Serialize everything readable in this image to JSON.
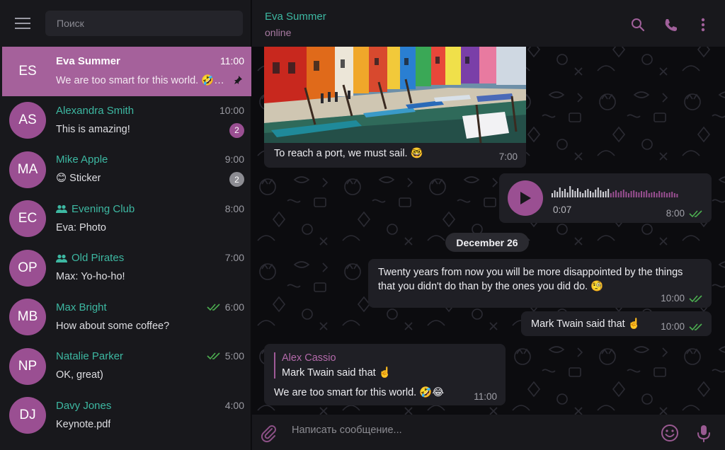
{
  "sidebar": {
    "search_placeholder": "Поиск",
    "chats": [
      {
        "initials": "ES",
        "name": "Eva Summer",
        "time": "11:00",
        "preview": "We are too smart for this world. 🤣😂",
        "pinned": true,
        "active": true,
        "group": false,
        "badge": "",
        "read": false
      },
      {
        "initials": "AS",
        "name": "Alexandra Smith",
        "time": "10:00",
        "preview": "This is amazing!",
        "badge": "2",
        "badge_style": "accent",
        "group": false,
        "read": false
      },
      {
        "initials": "MA",
        "name": "Mike Apple",
        "time": "9:00",
        "preview": "😊 Sticker",
        "badge": "2",
        "badge_style": "muted",
        "group": false,
        "read": false
      },
      {
        "initials": "EC",
        "name": "Evening Club",
        "time": "8:00",
        "preview": "Eva: Photo",
        "badge": "",
        "group": true,
        "read": false
      },
      {
        "initials": "OP",
        "name": "Old Pirates",
        "time": "7:00",
        "preview": "Max: Yo-ho-ho!",
        "badge": "",
        "group": true,
        "read": false
      },
      {
        "initials": "MB",
        "name": "Max Bright",
        "time": "6:00",
        "preview": "How about some coffee?",
        "badge": "",
        "group": false,
        "read": true
      },
      {
        "initials": "NP",
        "name": "Natalie Parker",
        "time": "5:00",
        "preview": "OK, great)",
        "badge": "",
        "group": false,
        "read": true
      },
      {
        "initials": "DJ",
        "name": "Davy Jones",
        "time": "4:00",
        "preview": "Keynote.pdf",
        "badge": "",
        "group": false,
        "read": false
      }
    ]
  },
  "header": {
    "name": "Eva Summer",
    "status": "online"
  },
  "messages": {
    "photo": {
      "caption": "To reach a port, we must sail. 🤓",
      "time": "7:00"
    },
    "voice": {
      "duration": "0:07",
      "time": "8:00",
      "progress": 0.45
    },
    "date_separator": "December 26",
    "quote": {
      "text": "Twenty years from now you will be more disappointed by the things that you didn't do than by the ones you did do. 🧐",
      "time": "10:00"
    },
    "twain": {
      "text": "Mark Twain said that ☝️",
      "time": "10:00"
    },
    "reply": {
      "author": "Alex Cassio",
      "quoted": "Mark Twain said that ☝️",
      "text": "We are too smart for this world. 🤣😂",
      "time": "11:00"
    }
  },
  "composer": {
    "placeholder": "Написать сообщение..."
  },
  "colors": {
    "accent": "#9a4f92",
    "active_row": "#a5619b",
    "name_teal": "#3db8a2",
    "check_green": "#4caf50"
  }
}
